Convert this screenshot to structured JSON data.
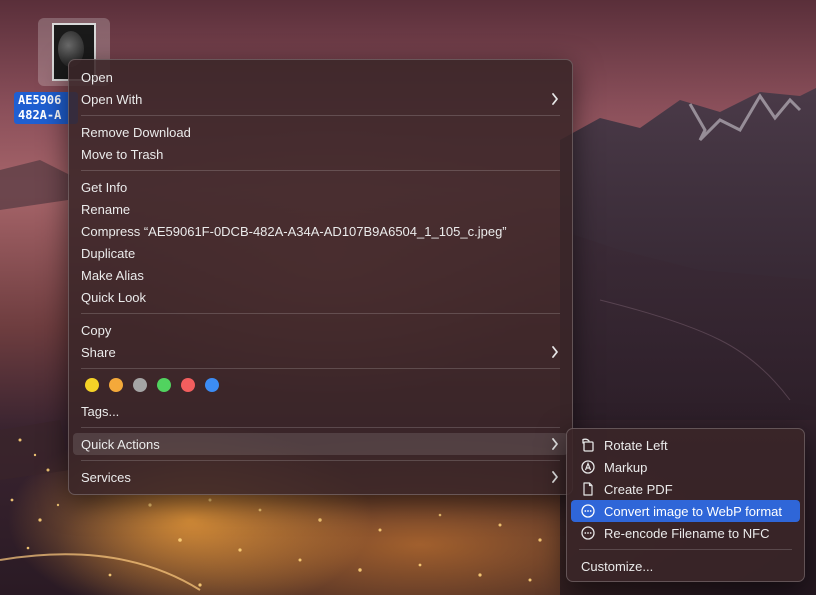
{
  "desktop": {
    "file_label": "AE5906\n482A-A",
    "icon_name": "jpeg-file-icon"
  },
  "menu": {
    "open": "Open",
    "open_with": "Open With",
    "remove_download": "Remove Download",
    "move_to_trash": "Move to Trash",
    "get_info": "Get Info",
    "rename": "Rename",
    "compress": "Compress “AE59061F-0DCB-482A-A34A-AD107B9A6504_1_105_c.jpeg”",
    "duplicate": "Duplicate",
    "make_alias": "Make Alias",
    "quick_look": "Quick Look",
    "copy": "Copy",
    "share": "Share",
    "tags": "Tags...",
    "quick_actions": "Quick Actions",
    "services": "Services",
    "tag_colors": [
      "#f5d327",
      "#f4a93a",
      "#a5a5a5",
      "#51d35f",
      "#f25e5e",
      "#3c8cf4"
    ]
  },
  "submenu": {
    "rotate_left": "Rotate Left",
    "markup": "Markup",
    "create_pdf": "Create PDF",
    "convert_webp": "Convert image to WebP format",
    "reencode": "Re-encode Filename to NFC",
    "customize": "Customize..."
  },
  "colors": {
    "highlight": "#2f66d8",
    "selection": "#1f5fd1"
  }
}
